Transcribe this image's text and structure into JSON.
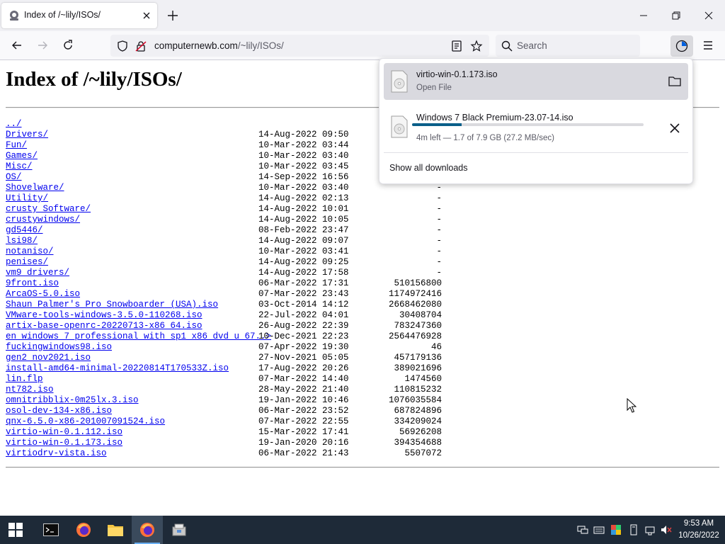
{
  "tab": {
    "title": "Index of /~lily/ISOs/"
  },
  "urlbar": {
    "domain": "computernewb.com",
    "path": "/~lily/ISOs/"
  },
  "search": {
    "placeholder": "Search"
  },
  "page": {
    "heading": "Index of /~lily/ISOs/"
  },
  "listing": [
    {
      "name": "../",
      "date": "",
      "size": ""
    },
    {
      "name": "Drivers/",
      "date": "14-Aug-2022 09:50",
      "size": "-"
    },
    {
      "name": "Fun/",
      "date": "10-Mar-2022 03:44",
      "size": "-"
    },
    {
      "name": "Games/",
      "date": "10-Mar-2022 03:40",
      "size": "-"
    },
    {
      "name": "Misc/",
      "date": "10-Mar-2022 03:45",
      "size": "-"
    },
    {
      "name": "OS/",
      "date": "14-Sep-2022 16:56",
      "size": "-"
    },
    {
      "name": "Shovelware/",
      "date": "10-Mar-2022 03:40",
      "size": "-"
    },
    {
      "name": "Utility/",
      "date": "14-Aug-2022 02:13",
      "size": "-"
    },
    {
      "name": "crusty Software/",
      "date": "14-Aug-2022 10:01",
      "size": "-"
    },
    {
      "name": "crustywindows/",
      "date": "14-Aug-2022 10:05",
      "size": "-"
    },
    {
      "name": "gd5446/",
      "date": "08-Feb-2022 23:47",
      "size": "-"
    },
    {
      "name": "lsi98/",
      "date": "14-Aug-2022 09:07",
      "size": "-"
    },
    {
      "name": "notaniso/",
      "date": "10-Mar-2022 03:41",
      "size": "-"
    },
    {
      "name": "penises/",
      "date": "14-Aug-2022 09:25",
      "size": "-"
    },
    {
      "name": "vm9_drivers/",
      "date": "14-Aug-2022 17:58",
      "size": "-"
    },
    {
      "name": "9front.iso",
      "date": "06-Mar-2022 17:31",
      "size": "510156800"
    },
    {
      "name": "ArcaOS-5.0.iso",
      "date": "07-Mar-2022 23:43",
      "size": "1174972416"
    },
    {
      "name": "Shaun Palmer's Pro Snowboarder (USA).iso",
      "date": "03-Oct-2014 14:12",
      "size": "2668462080"
    },
    {
      "name": "VMware-tools-windows-3.5.0-110268.iso",
      "date": "22-Jul-2022 04:01",
      "size": "30408704"
    },
    {
      "name": "artix-base-openrc-20220713-x86_64.iso",
      "date": "26-Aug-2022 22:39",
      "size": "783247360"
    },
    {
      "name": "en_windows_7_professional_with_sp1_x86_dvd_u_67..>",
      "date": "10-Dec-2021 22:23",
      "size": "2564476928"
    },
    {
      "name": "fuckingwindows98.iso",
      "date": "07-Apr-2022 19:30",
      "size": "46"
    },
    {
      "name": "gen2_nov2021.iso",
      "date": "27-Nov-2021 05:05",
      "size": "457179136"
    },
    {
      "name": "install-amd64-minimal-20220814T170533Z.iso",
      "date": "17-Aug-2022 20:26",
      "size": "389021696"
    },
    {
      "name": "lin.flp",
      "date": "07-Mar-2022 14:40",
      "size": "1474560"
    },
    {
      "name": "nt782.iso",
      "date": "28-May-2022 21:40",
      "size": "110815232"
    },
    {
      "name": "omnitribblix-0m25lx.3.iso",
      "date": "19-Jan-2022 10:46",
      "size": "1076035584"
    },
    {
      "name": "osol-dev-134-x86.iso",
      "date": "06-Mar-2022 23:52",
      "size": "687824896"
    },
    {
      "name": "qnx-6.5.0-x86-201007091524.iso",
      "date": "07-Mar-2022 22:55",
      "size": "334209024"
    },
    {
      "name": "virtio-win-0.1.112.iso",
      "date": "15-Mar-2022 17:41",
      "size": "56926208"
    },
    {
      "name": "virtio-win-0.1.173.iso",
      "date": "19-Jan-2020 20:16",
      "size": "394354688"
    },
    {
      "name": "virtiodrv-vista.iso",
      "date": "06-Mar-2022 21:43",
      "size": "5507072"
    }
  ],
  "downloads": {
    "items": [
      {
        "name": "virtio-win-0.1.173.iso",
        "status": "Open File"
      },
      {
        "name": "Windows 7 Black Premium-23.07-14.iso",
        "status": "4m left — 1.7 of 7.9 GB (27.2 MB/sec)",
        "progress": 0.215
      }
    ],
    "show_all": "Show all downloads"
  },
  "taskbar": {
    "clock_time": "9:53 AM",
    "clock_date": "10/26/2022"
  },
  "colors": {
    "link": "#0000ee",
    "progress_fill": "#0a5f89",
    "taskbar_bg": "#1e2a38"
  }
}
